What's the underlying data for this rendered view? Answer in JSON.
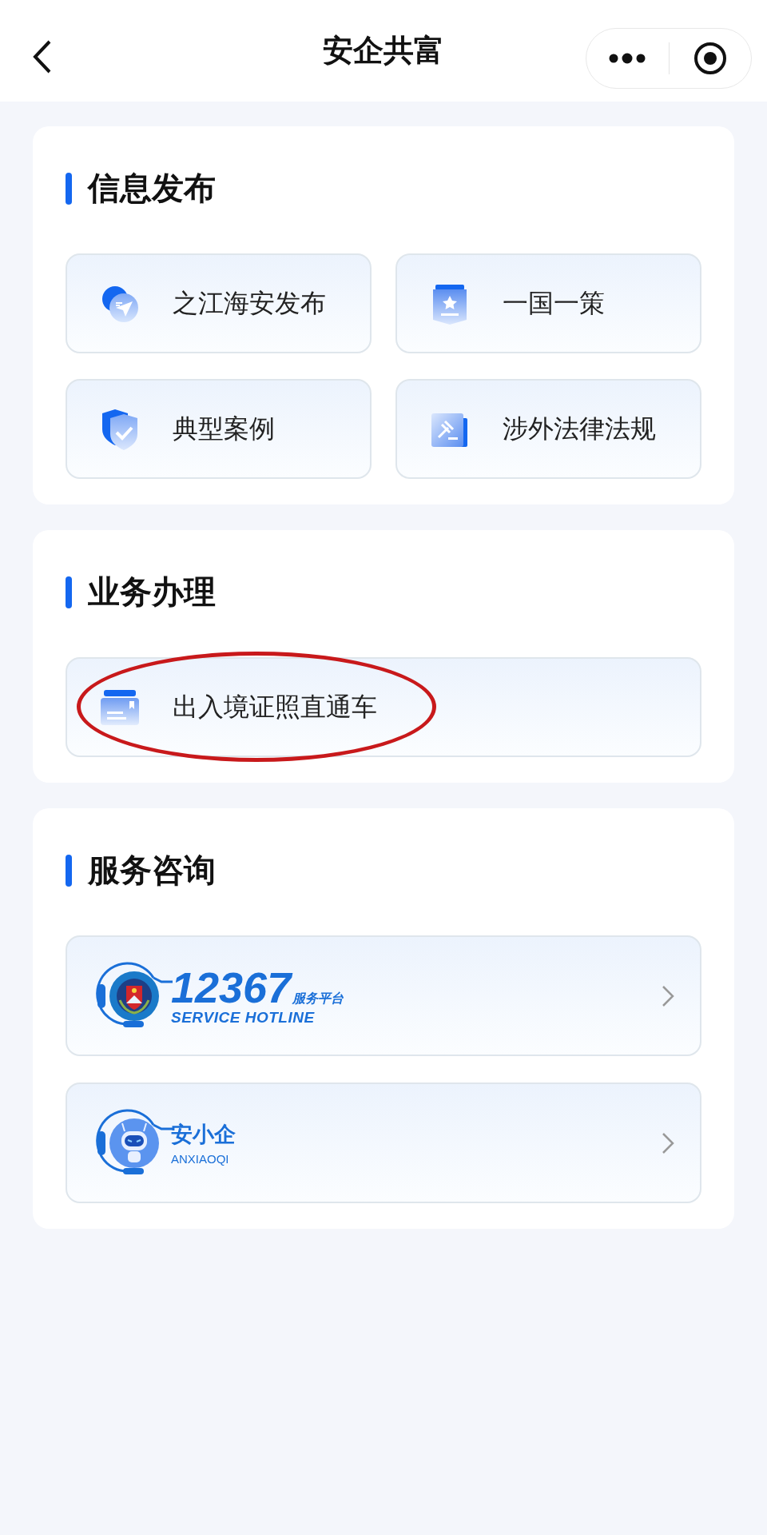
{
  "header": {
    "title": "安企共富"
  },
  "sections": [
    {
      "title": "信息发布",
      "kind": "grid",
      "items": [
        {
          "label": "之江海安发布"
        },
        {
          "label": "一国一策"
        },
        {
          "label": "典型案例"
        },
        {
          "label": "涉外法律法规"
        }
      ]
    },
    {
      "title": "业务办理",
      "kind": "wide",
      "items": [
        {
          "label": "出入境证照直通车",
          "circled": true
        }
      ]
    },
    {
      "title": "服务咨询",
      "kind": "service",
      "items": [
        {
          "kind": "hotline",
          "number": "12367",
          "tagline": "服务平台",
          "subtitle": "SERVICE HOTLINE"
        },
        {
          "kind": "assistant",
          "name": "安小企",
          "subtitle": "ANXIAOQI"
        }
      ]
    }
  ]
}
